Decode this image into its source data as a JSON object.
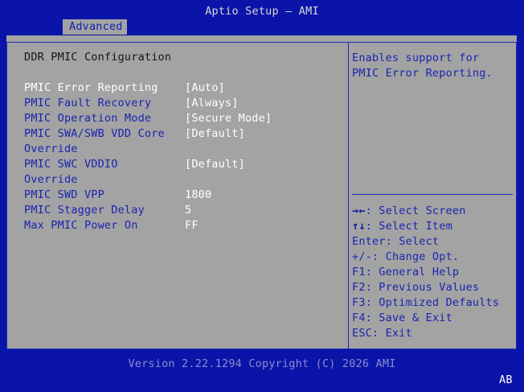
{
  "window": {
    "title": "Aptio Setup – AMI"
  },
  "tabs": [
    {
      "label": "Advanced"
    }
  ],
  "main": {
    "heading": "DDR PMIC Configuration",
    "settings": [
      {
        "label": "PMIC Error Reporting",
        "value": "[Auto]"
      },
      {
        "label": "PMIC Fault Recovery",
        "value": "[Always]"
      },
      {
        "label": "PMIC Operation Mode",
        "value": "[Secure Mode]"
      },
      {
        "label": "PMIC SWA/SWB VDD Core",
        "label2": "Override",
        "value": "[Default]"
      },
      {
        "label": "PMIC SWC VDDIO",
        "label2": "Override",
        "value": "[Default]"
      },
      {
        "label": "PMIC SWD VPP",
        "value": "1800"
      },
      {
        "label": "PMIC Stagger Delay",
        "value": "5"
      },
      {
        "label": "Max PMIC Power On",
        "value": "FF"
      }
    ]
  },
  "help": {
    "text": "Enables support for\nPMIC Error Reporting."
  },
  "keys": [
    {
      "key": "→←",
      "desc": ": Select Screen"
    },
    {
      "key": "↑↓",
      "desc": ": Select Item"
    },
    {
      "key": "",
      "desc": "Enter: Select"
    },
    {
      "key": "",
      "desc": "+/-: Change Opt."
    },
    {
      "key": "",
      "desc": "F1: General Help"
    },
    {
      "key": "",
      "desc": "F2: Previous Values"
    },
    {
      "key": "",
      "desc": "F3: Optimized Defaults"
    },
    {
      "key": "",
      "desc": "F4: Save & Exit"
    },
    {
      "key": "",
      "desc": "ESC: Exit"
    }
  ],
  "footer": {
    "version": "Version 2.22.1294 Copyright (C) 2026 AMI",
    "badge": "AB"
  },
  "colors": {
    "background": "#0a14a8",
    "panel": "#a3a3a3",
    "label": "#1a24b0",
    "value": "#ffffff",
    "selected": "#ffffff"
  }
}
